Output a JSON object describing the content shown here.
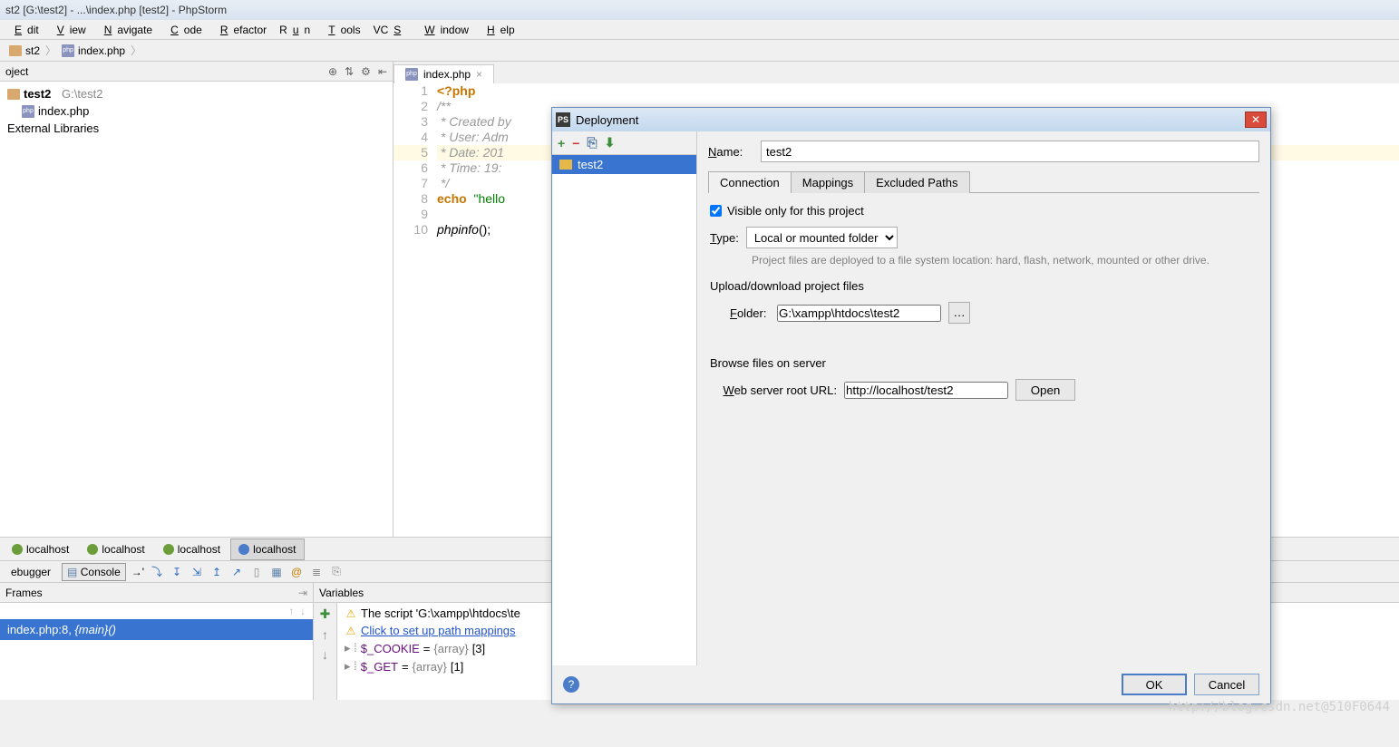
{
  "window": {
    "title": "st2 [G:\\test2] - ...\\index.php [test2] - PhpStorm"
  },
  "menu": {
    "edit": "Edit",
    "view": "View",
    "navigate": "Navigate",
    "code": "Code",
    "refactor": "Refactor",
    "run": "Run",
    "tools": "Tools",
    "vcs": "VCS",
    "window": "Window",
    "help": "Help"
  },
  "breadcrumb": {
    "item1": "st2",
    "item2": "index.php"
  },
  "projectHeader": {
    "label": "oject"
  },
  "tree": {
    "root": "test2",
    "rootPath": "G:\\test2",
    "file": "index.php",
    "ext": "External Libraries"
  },
  "editor": {
    "tabLabel": "index.php",
    "lines": {
      "1": "<?php",
      "2": "/**",
      "3": " * Created by",
      "4": " * User: Adm",
      "5": " * Date: 201",
      "6": " * Time: 19:",
      "7": " */",
      "8a": "echo",
      "8b": "\"hello",
      "10": "phpinfo",
      "10b": "();"
    },
    "nums": [
      "1",
      "2",
      "3",
      "4",
      "5",
      "6",
      "7",
      "8",
      "9",
      "10"
    ]
  },
  "debugTabs": {
    "t1": "localhost",
    "t2": "localhost",
    "t3": "localhost",
    "t4": "localhost"
  },
  "debuggerRow": {
    "debugger": "ebugger",
    "console": "Console"
  },
  "frames": {
    "header": "Frames",
    "row": "index.php:8,",
    "rowItalic": "{main}()"
  },
  "vars": {
    "header": "Variables",
    "v1": "The script 'G:\\xampp\\htdocs\\te",
    "v2": "Click to set up path mappings",
    "v3a": "$_COOKIE",
    "v3b": " = ",
    "v3c": "{array}",
    "v3d": " [3]",
    "v4a": "$_GET",
    "v4b": " = ",
    "v4c": "{array}",
    "v4d": " [1]"
  },
  "dialog": {
    "title": "Deployment",
    "listItem": "test2",
    "nameLabel": "Name:",
    "nameValue": "test2",
    "tabs": {
      "conn": "Connection",
      "map": "Mappings",
      "excl": "Excluded Paths"
    },
    "visibleChk": "Visible only for this project",
    "typeLabel": "Type:",
    "typeValue": "Local or mounted folder",
    "typeDescr": "Project files are deployed to a file system location: hard, flash, network, mounted or other drive.",
    "uploadTitle": "Upload/download project files",
    "folderLabel": "Folder:",
    "folderValue": "G:\\xampp\\htdocs\\test2",
    "browseTitle": "Browse files on server",
    "urlLabel": "Web server root URL:",
    "urlValue": "http://localhost/test2",
    "openBtn": "Open",
    "ok": "OK",
    "cancel": "Cancel"
  },
  "watermark": "http://blog.csdn.net@510F0644"
}
